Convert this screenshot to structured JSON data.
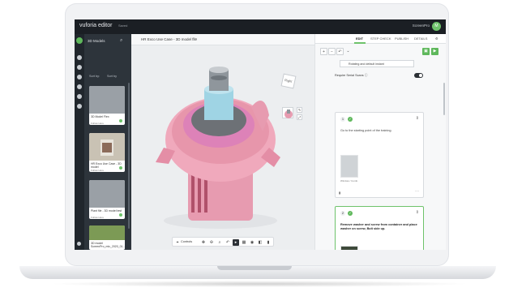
{
  "app": {
    "brand": "vuforia editor",
    "status": "Saved",
    "user_initial": "M",
    "user_name": "ScreenPro"
  },
  "sidebar": {
    "title": "3D Models",
    "sort": "Sort by:",
    "filter": "Sort by",
    "cards": [
      {
        "title": "3D Model Flex",
        "meta": "Follow Here"
      },
      {
        "title": "HR Exco Use Case - 3D model",
        "meta": "Follow Here"
      },
      {
        "title": "Plant file - 3D model test",
        "meta": "Follow Here"
      },
      {
        "title": "3D model ScreenPro_mix_2020_01...",
        "meta": "Follow Here"
      }
    ]
  },
  "viewer": {
    "title": "HR Exco Use Case - 3D model file",
    "menu": "⋯",
    "cube": "Right",
    "toolbar_label": "Controls"
  },
  "tabs": [
    "EDIT",
    "STEP CHECK",
    "PUBLISH",
    "DETAILS"
  ],
  "right": {
    "select": "Rotating and default instant",
    "toggle_label": "Require Serial Scans ⓘ",
    "steps": [
      {
        "num": "1",
        "text": "Go to the starting point of the training.",
        "caption": "Window / Comb."
      },
      {
        "num": "2",
        "text": "Remove washer and screw from container and place washer on screw, Bolt side up.",
        "caption": ""
      }
    ]
  }
}
